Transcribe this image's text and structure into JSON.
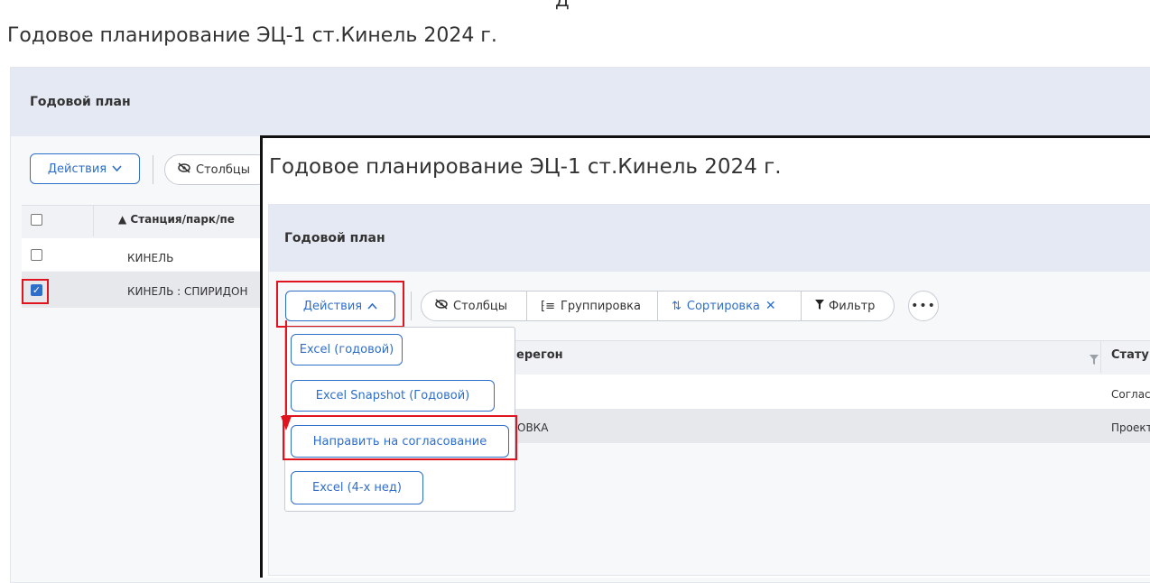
{
  "background": {
    "title": "Годовое планирование ЭЦ-1 ст.Кинель 2024 г.",
    "card_title": "Годовой план",
    "actions_label": "Действия",
    "columns_label": "Столбцы",
    "table_header": "▲ Станция/парк/пе",
    "rows": [
      "КИНЕЛЬ",
      "КИНЕЛЬ : СПИРИДОН"
    ]
  },
  "overlay": {
    "title": "Годовое планирование ЭЦ-1 ст.Кинель 2024 г.",
    "card_title": "Годовой план",
    "toolbar": {
      "actions_label": "Действия",
      "columns_label": "Столбцы",
      "grouping_label": "Группировка",
      "sorting_label": "Сортировка",
      "filter_label": "Фильтр"
    },
    "table_header": "ерегон",
    "status_header": "Стату",
    "rows": [
      {
        "text": "",
        "status": "Соглас"
      },
      {
        "text": "ОВКА",
        "status": "Проект"
      }
    ],
    "menu_items": [
      "Excel (годовой)",
      "Excel Snapshot (Годовой)",
      "Направить на согласование",
      "Excel (4-х нед)"
    ]
  },
  "colors": {
    "accent": "#2f6ec9",
    "highlight": "#e0141e"
  }
}
